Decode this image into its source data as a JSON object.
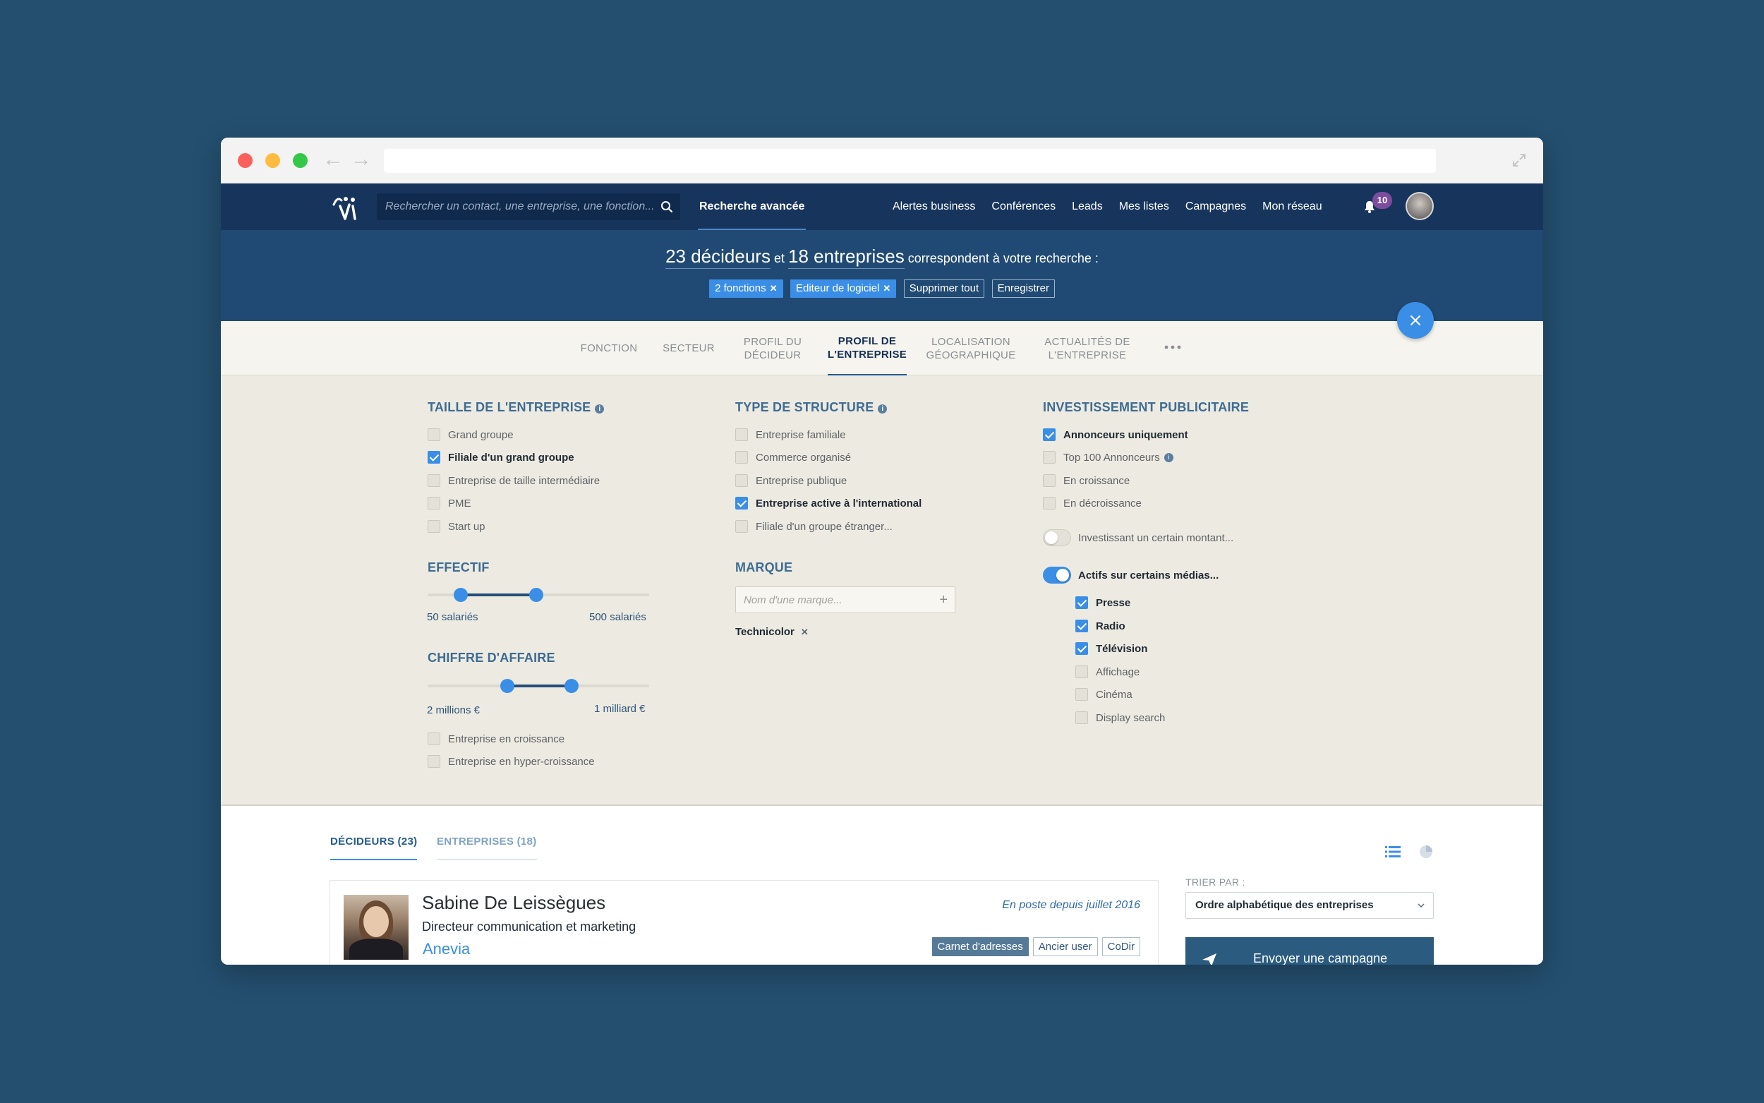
{
  "header": {
    "search_placeholder": "Rechercher un contact, une entreprise, une fonction...",
    "advanced_search": "Recherche avancée",
    "nav": [
      "Alertes business",
      "Conférences",
      "Leads",
      "Mes listes",
      "Campagnes",
      "Mon réseau"
    ],
    "notifications_count": "10"
  },
  "banner": {
    "decideurs": "23 décideurs",
    "et": "et",
    "entreprises": "18 entreprises",
    "suffix": "correspondent à votre recherche :",
    "chips": {
      "fonctions": "2 fonctions",
      "editeur": "Editeur de logiciel",
      "supprimer": "Supprimer tout",
      "enregistrer": "Enregistrer"
    }
  },
  "tabs": {
    "fonction": "FONCTION",
    "secteur": "SECTEUR",
    "profil_decideur_1": "PROFIL DU",
    "profil_decideur_2": "DÉCIDEUR",
    "profil_entreprise_1": "PROFIL DE",
    "profil_entreprise_2": "L'ENTREPRISE",
    "localisation_1": "LOCALISATION",
    "localisation_2": "GÉOGRAPHIQUE",
    "actualites_1": "ACTUALITÉS DE",
    "actualites_2": "L'ENTREPRISE"
  },
  "taille": {
    "title": "TAILLE DE L'ENTREPRISE",
    "items": [
      "Grand groupe",
      "Filiale d'un grand groupe",
      "Entreprise de taille intermédiaire",
      "PME",
      "Start up"
    ],
    "checked": [
      false,
      true,
      false,
      false,
      false
    ]
  },
  "effectif": {
    "title": "EFFECTIF",
    "min_label": "50 salariés",
    "max_label": "500 salariés",
    "range": [
      0.15,
      0.49
    ]
  },
  "chiffre": {
    "title": "CHIFFRE D'AFFAIRE",
    "min_label": "2 millions €",
    "max_label": "1 milliard €",
    "range": [
      0.36,
      0.65
    ],
    "items": [
      "Entreprise en croissance",
      "Entreprise en hyper-croissance"
    ],
    "checked": [
      false,
      false
    ]
  },
  "structure": {
    "title": "TYPE DE STRUCTURE",
    "items": [
      "Entreprise familiale",
      "Commerce organisé",
      "Entreprise publique",
      "Entreprise active à l'international",
      "Filiale d'un groupe étranger..."
    ],
    "checked": [
      false,
      false,
      false,
      true,
      false
    ]
  },
  "marque": {
    "title": "MARQUE",
    "placeholder": "Nom d'une marque...",
    "tag": "Technicolor"
  },
  "investissement": {
    "title": "INVESTISSEMENT PUBLICITAIRE",
    "items": [
      "Annonceurs uniquement",
      "Top 100 Annonceurs",
      "En croissance",
      "En décroissance"
    ],
    "checked": [
      true,
      false,
      false,
      false
    ],
    "toggle_montant": "Investissant un certain montant...",
    "toggle_montant_on": false,
    "toggle_medias": "Actifs sur certains médias...",
    "toggle_medias_on": true,
    "medias": [
      "Presse",
      "Radio",
      "Télévision",
      "Affichage",
      "Cinéma",
      "Display search"
    ],
    "medias_checked": [
      true,
      true,
      true,
      false,
      false,
      false
    ]
  },
  "results": {
    "tab_decideurs": "DÉCIDEURS (23)",
    "tab_entreprises": "ENTREPRISES (18)",
    "card": {
      "name": "Sabine De Leissègues",
      "role": "Directeur communication et marketing",
      "company": "Anevia",
      "since": "En poste depuis juillet 2016",
      "tags": [
        "Carnet d'adresses",
        "Ancier user",
        "CoDir"
      ]
    },
    "sort_label": "TRIER PAR :",
    "sort_value": "Ordre alphabétique des entreprises",
    "campaign_button": "Envoyer une campagne"
  },
  "colors": {
    "background": "#244f6f",
    "appbar": "#17355c",
    "banner": "#204a73",
    "accent": "#3b8ee6",
    "panel": "#edebe1"
  }
}
